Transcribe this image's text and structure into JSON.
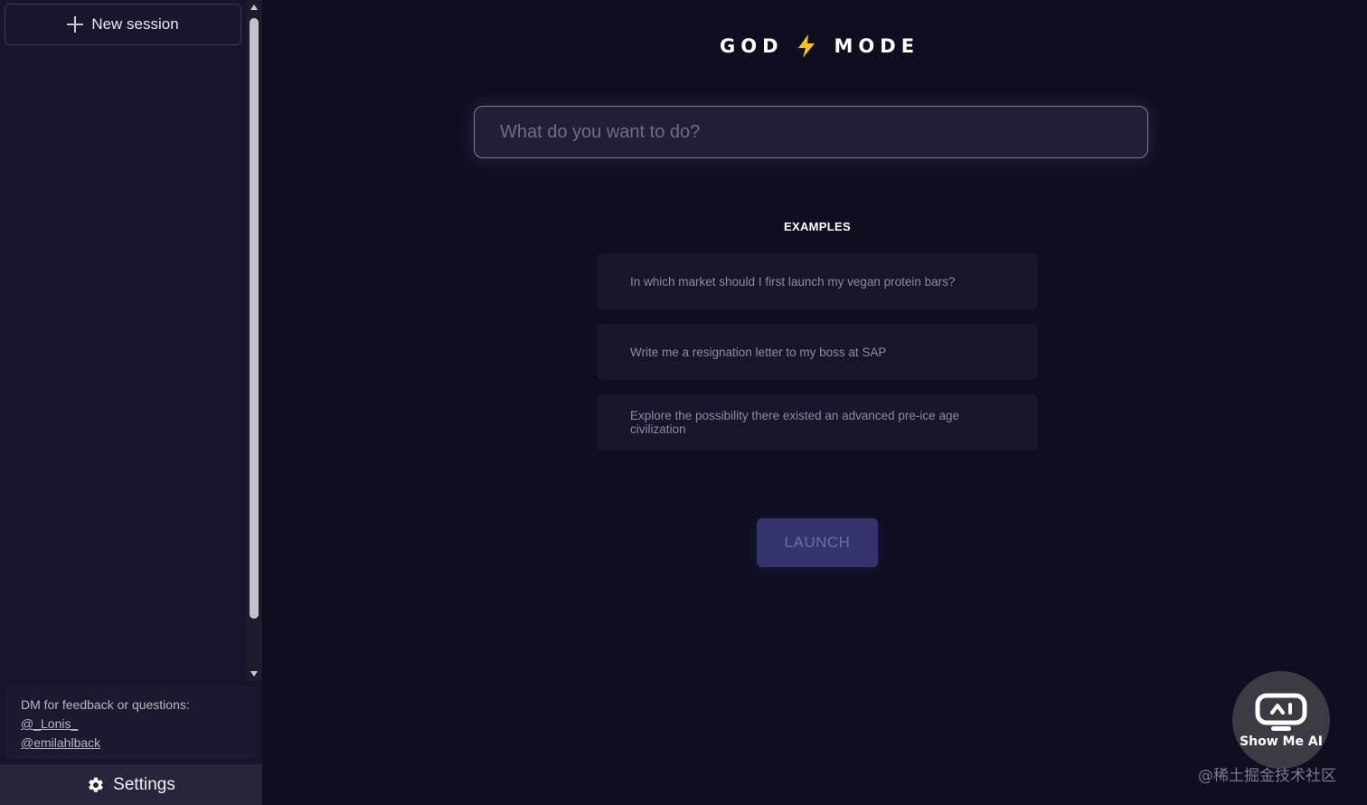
{
  "sidebar": {
    "new_session_label": "New session",
    "feedback": {
      "prompt": "DM for feedback or questions:",
      "handle_1": "@_Lonis_",
      "handle_2": "@emilahlback"
    },
    "settings_label": "Settings"
  },
  "main": {
    "brand_left": "GOD",
    "brand_right": "MODE",
    "prompt_placeholder": "What do you want to do?",
    "examples_title": "EXAMPLES",
    "examples": [
      "In which market should I first launch my vegan protein bars?",
      "Write me a resignation letter to my boss at SAP",
      "Explore the possibility there existed an advanced pre-ice age civilization"
    ],
    "launch_label": "LAUNCH"
  },
  "watermark": {
    "brand": "Show Me AI",
    "text": "@稀土掘金技术社区"
  },
  "colors": {
    "background": "#0f0e21",
    "sidebar": "#16152b",
    "launch_button": "#34346a",
    "bolt": "#f5c518"
  }
}
